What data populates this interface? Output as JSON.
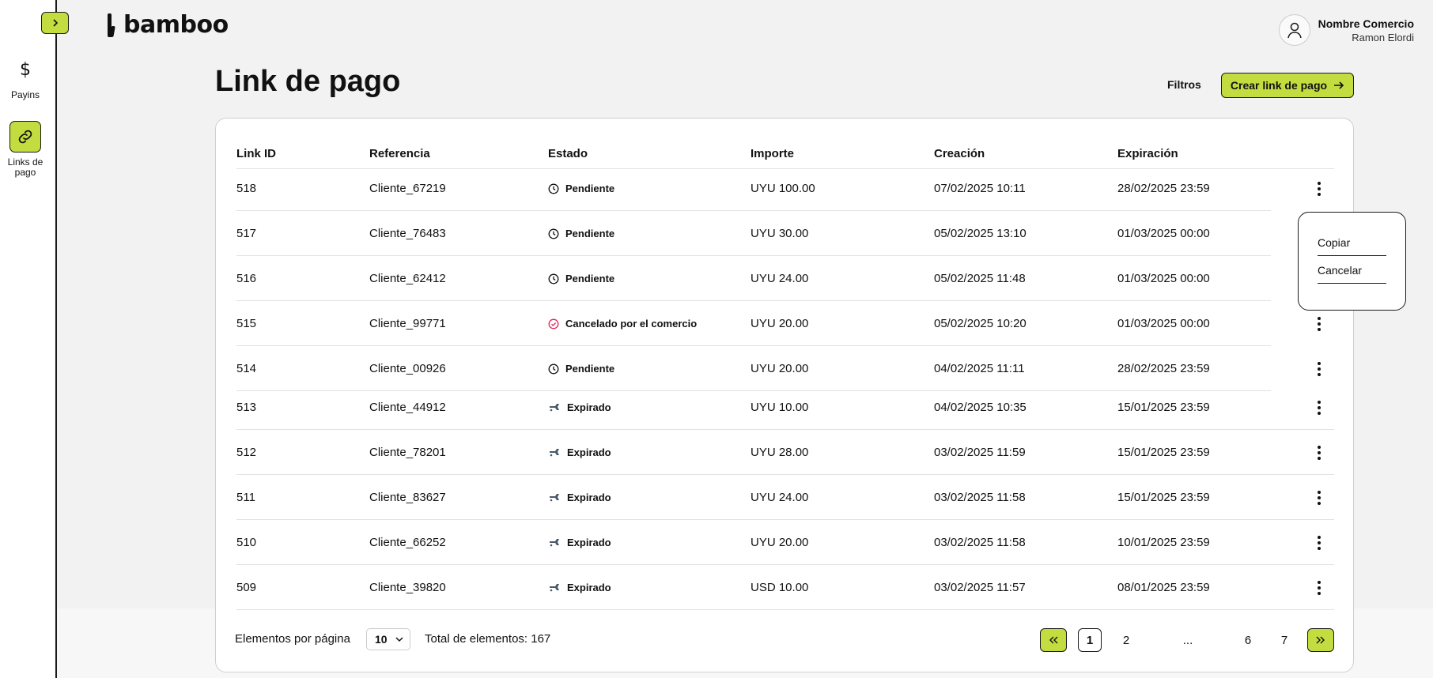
{
  "brand": {
    "name": "bamboo",
    "accent": "#c3dc3f"
  },
  "sidebar": {
    "items": [
      {
        "label": "Payins",
        "icon": "dollar-icon"
      },
      {
        "label": "Links de pago",
        "icon": "link-icon",
        "active": true
      }
    ]
  },
  "user": {
    "name": "Nombre Comercio",
    "sub": "Ramon Elordi"
  },
  "page": {
    "title": "Link de pago",
    "filters_label": "Filtros",
    "create_label": "Crear link de pago"
  },
  "table": {
    "columns": [
      "Link ID",
      "Referencia",
      "Estado",
      "Importe",
      "Creación",
      "Expiración"
    ],
    "rows": [
      {
        "id": "518",
        "ref": "Cliente_67219",
        "status": "Pendiente",
        "status_type": "pending",
        "amount": "UYU 100.00",
        "created": "07/02/2025 10:11",
        "expires": "28/02/2025 23:59"
      },
      {
        "id": "517",
        "ref": "Cliente_76483",
        "status": "Pendiente",
        "status_type": "pending",
        "amount": "UYU 30.00",
        "created": "05/02/2025 13:10",
        "expires": "01/03/2025 00:00"
      },
      {
        "id": "516",
        "ref": "Cliente_62412",
        "status": "Pendiente",
        "status_type": "pending",
        "amount": "UYU 24.00",
        "created": "05/02/2025 11:48",
        "expires": "01/03/2025 00:00"
      },
      {
        "id": "515",
        "ref": "Cliente_99771",
        "status": "Cancelado por el comercio",
        "status_type": "cancelled",
        "amount": "UYU 20.00",
        "created": "05/02/2025 10:20",
        "expires": "01/03/2025 00:00"
      },
      {
        "id": "514",
        "ref": "Cliente_00926",
        "status": "Pendiente",
        "status_type": "pending",
        "amount": "UYU 20.00",
        "created": "04/02/2025 11:11",
        "expires": "28/02/2025 23:59"
      },
      {
        "id": "513",
        "ref": "Cliente_44912",
        "status": "Expirado",
        "status_type": "expired",
        "amount": "UYU 10.00",
        "created": "04/02/2025 10:35",
        "expires": "15/01/2025 23:59"
      },
      {
        "id": "512",
        "ref": "Cliente_78201",
        "status": "Expirado",
        "status_type": "expired",
        "amount": "UYU 28.00",
        "created": "03/02/2025 11:59",
        "expires": "15/01/2025 23:59"
      },
      {
        "id": "511",
        "ref": "Cliente_83627",
        "status": "Expirado",
        "status_type": "expired",
        "amount": "UYU 24.00",
        "created": "03/02/2025 11:58",
        "expires": "15/01/2025 23:59"
      },
      {
        "id": "510",
        "ref": "Cliente_66252",
        "status": "Expirado",
        "status_type": "expired",
        "amount": "UYU 20.00",
        "created": "03/02/2025 11:58",
        "expires": "10/01/2025 23:59"
      },
      {
        "id": "509",
        "ref": "Cliente_39820",
        "status": "Expirado",
        "status_type": "expired",
        "amount": "USD 10.00",
        "created": "03/02/2025 11:57",
        "expires": "08/01/2025 23:59"
      }
    ]
  },
  "row_menu": {
    "items": [
      "Copiar",
      "Cancelar"
    ]
  },
  "footer": {
    "per_page_label": "Elementos por página",
    "per_page_value": "10",
    "total_label": "Total de elementos: 167",
    "pages": [
      "1",
      "2",
      "...",
      "6",
      "7"
    ],
    "current_page": "1"
  },
  "colors": {
    "cancelled": "#e0245e",
    "expired_icon": "#4a5a6a"
  }
}
